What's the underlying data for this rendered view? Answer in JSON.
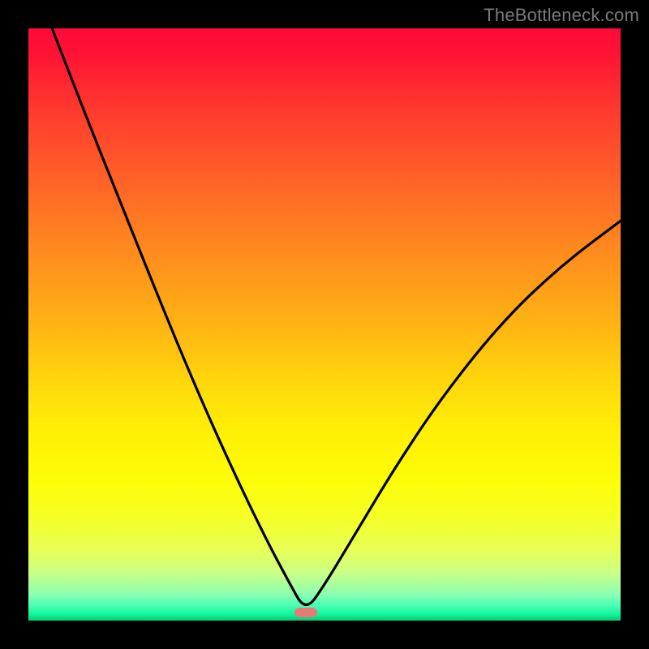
{
  "attribution": "TheBottleneck.com",
  "marker": {
    "x": 0.468,
    "y_top_fraction": 0.986
  },
  "colors": {
    "frame": "#000000",
    "attribution": "#7a7a7a",
    "curve": "#000000",
    "marker": "#e77a74",
    "gradient_top": "#ff0a3a",
    "gradient_bottom": "#07c772"
  },
  "chart_data": {
    "type": "line",
    "title": "",
    "xlabel": "",
    "ylabel": "",
    "xlim": [
      0,
      1
    ],
    "ylim": [
      0,
      1
    ],
    "grid": false,
    "legend": false,
    "series": [
      {
        "name": "curve",
        "x": [
          0.04,
          0.1,
          0.16,
          0.22,
          0.28,
          0.34,
          0.4,
          0.44,
          0.468,
          0.5,
          0.56,
          0.62,
          0.7,
          0.8,
          0.9,
          1.0
        ],
        "y_top_fraction": [
          0.0,
          0.155,
          0.305,
          0.455,
          0.6,
          0.735,
          0.86,
          0.935,
          0.985,
          0.94,
          0.84,
          0.74,
          0.62,
          0.495,
          0.4,
          0.325
        ]
      }
    ],
    "annotations": [
      {
        "text": "TheBottleneck.com",
        "position": "top-right"
      }
    ],
    "notes": "x and y values are normalized fractions in [0,1]; y_top_fraction measured from top edge (0) to bottom edge (1). Axis ticks/labels are not shown in the image."
  }
}
